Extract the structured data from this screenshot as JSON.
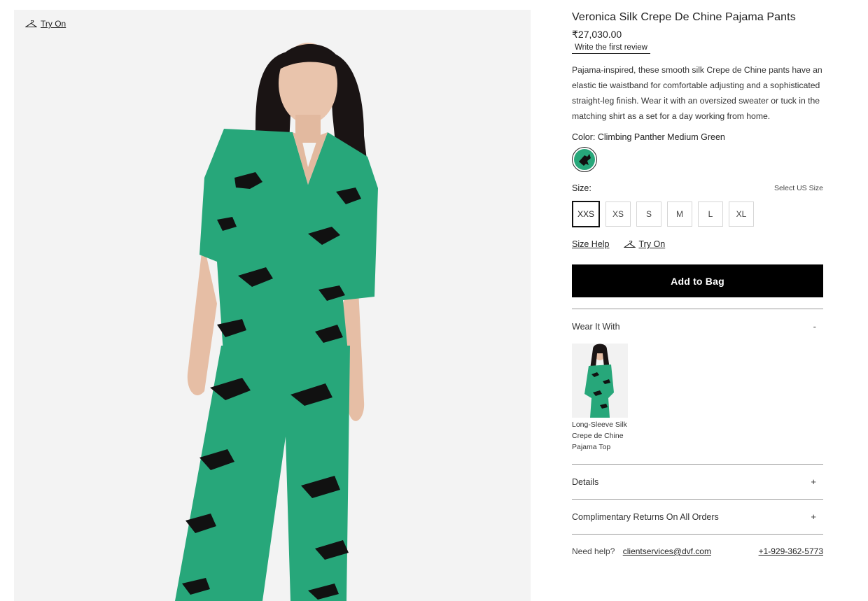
{
  "image": {
    "try_on_label": "Try On"
  },
  "product": {
    "title": "Veronica Silk Crepe De Chine Pajama Pants",
    "price": "₹27,030.00",
    "review_link": "Write the first review",
    "description": "Pajama-inspired, these smooth silk Crepe de Chine pants have an elastic tie waistband for comfortable adjusting and a sophisticated straight-leg finish. Wear it with an oversized sweater or tuck in the matching shirt as a set for a day working from home.",
    "color_label": "Color:",
    "color_value": "Climbing Panther Medium Green",
    "size_label": "Size:",
    "select_us_size": "Select US Size",
    "sizes": [
      "XXS",
      "XS",
      "S",
      "M",
      "L",
      "XL"
    ],
    "selected_size": "XXS",
    "size_help": "Size Help",
    "try_on_label": "Try On",
    "add_to_bag": "Add to Bag"
  },
  "wear_it_with": {
    "label": "Wear It With",
    "toggle": "-",
    "items": [
      {
        "name": "Long-Sleeve Silk Crepe de Chine Pajama Top"
      }
    ]
  },
  "accordions": {
    "details": {
      "label": "Details",
      "toggle": "+"
    },
    "returns": {
      "label": "Complimentary Returns On All Orders",
      "toggle": "+"
    }
  },
  "help": {
    "label": "Need help?",
    "email": "clientservices@dvf.com",
    "phone": "+1-929-362-5773"
  },
  "colors": {
    "garment_green": "#27a77a",
    "panther_black": "#111111",
    "button_black": "#000000"
  }
}
